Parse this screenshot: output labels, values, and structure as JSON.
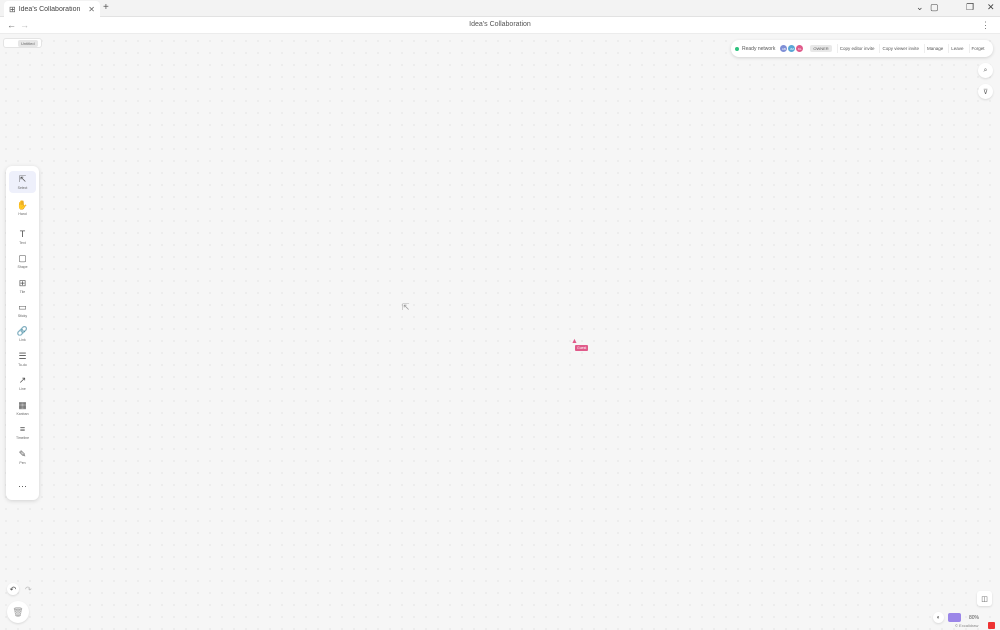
{
  "browser": {
    "tab_title": "Idea's Collaboration",
    "tab_icon": "grid-icon",
    "new_tab": "+",
    "window_controls": [
      "⌄",
      "▢",
      "❐",
      "✕"
    ]
  },
  "address": {
    "back": "←",
    "forward": "→",
    "page_title": "Idea's Collaboration",
    "menu": "⋮"
  },
  "board": {
    "chip_label": "Untitled"
  },
  "collab": {
    "status": "Ready network",
    "avatars": [
      {
        "initials": "AB",
        "color": "#7f8fd6"
      },
      {
        "initials": "JM",
        "color": "#5aa7d6"
      },
      {
        "initials": "KL",
        "color": "#e05a8a"
      }
    ],
    "badge": "OWNER",
    "buttons": [
      "Copy editor invite",
      "Copy viewer invite",
      "Manage",
      "Leave",
      "Forget"
    ]
  },
  "side": {
    "search": "⌕",
    "filter": "⊽"
  },
  "toolbar": {
    "tools": [
      {
        "label": "Select",
        "icon": "⇱",
        "name": "cursor-icon",
        "active": true
      },
      {
        "label": "Hand",
        "icon": "✋",
        "name": "hand-icon"
      },
      {
        "label": "Text",
        "icon": "T",
        "name": "text-icon"
      },
      {
        "label": "Shape",
        "icon": "▢",
        "name": "shape-icon"
      },
      {
        "label": "Tile",
        "icon": "⊞",
        "name": "tile-icon"
      },
      {
        "label": "Sticky",
        "icon": "▭",
        "name": "sticky-icon"
      },
      {
        "label": "Link",
        "icon": "🔗",
        "name": "link-icon"
      },
      {
        "label": "To-do",
        "icon": "☰",
        "name": "todo-icon"
      },
      {
        "label": "Line",
        "icon": "↗",
        "name": "line-icon"
      },
      {
        "label": "Kanban",
        "icon": "▦",
        "name": "kanban-icon"
      },
      {
        "label": "Timeline",
        "icon": "≡",
        "name": "timeline-icon"
      },
      {
        "label": "Pen",
        "icon": "✎",
        "name": "pen-icon"
      },
      {
        "label": "",
        "icon": "⋯",
        "name": "more-icon"
      }
    ]
  },
  "history": {
    "undo": "↶",
    "redo": "↷",
    "trash": "🗑"
  },
  "cursors": {
    "remote_name": "Guest",
    "remote_color": "#e05a8a"
  },
  "footer": {
    "map": "◫",
    "theme": "◐",
    "swatch": "#9b86e8",
    "zoom": "80%",
    "credit": "© Excalidraw"
  }
}
